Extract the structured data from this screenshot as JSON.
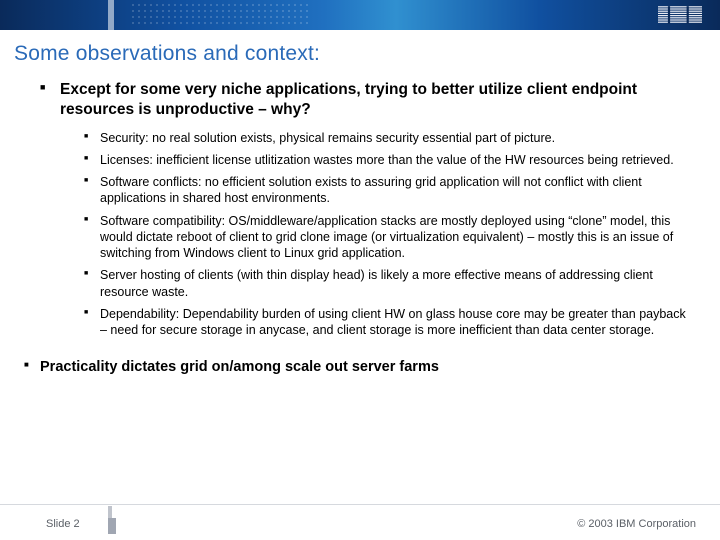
{
  "header": {
    "logo_alt": "IBM"
  },
  "title": "Some observations and context:",
  "main_points": [
    {
      "text": "Except for some very niche applications, trying to better utilize client endpoint resources is unproductive – why?",
      "sub": [
        "Security:  no real solution exists, physical remains security essential part of picture.",
        "Licenses:  inefficient license utlitization wastes more than the value of the HW resources being retrieved.",
        "Software conflicts:  no efficient solution exists to assuring grid application will not conflict with client applications in shared host environments.",
        "Software compatibility:  OS/middleware/application stacks are mostly deployed using “clone” model, this would dictate reboot of client to grid clone image (or virtualization equivalent) – mostly this is an issue of switching from Windows client to Linux grid application.",
        "Server hosting of clients (with thin display head) is likely a more effective means of addressing client resource waste.",
        "Dependability:  Dependability burden of using client HW on glass house core may be greater than payback – need for secure storage in anycase, and client storage is more inefficient than data center storage."
      ]
    }
  ],
  "closing_point": "Practicality dictates grid on/among scale out server farms",
  "footer": {
    "left": "Slide  2",
    "right": "© 2003 IBM Corporation"
  }
}
